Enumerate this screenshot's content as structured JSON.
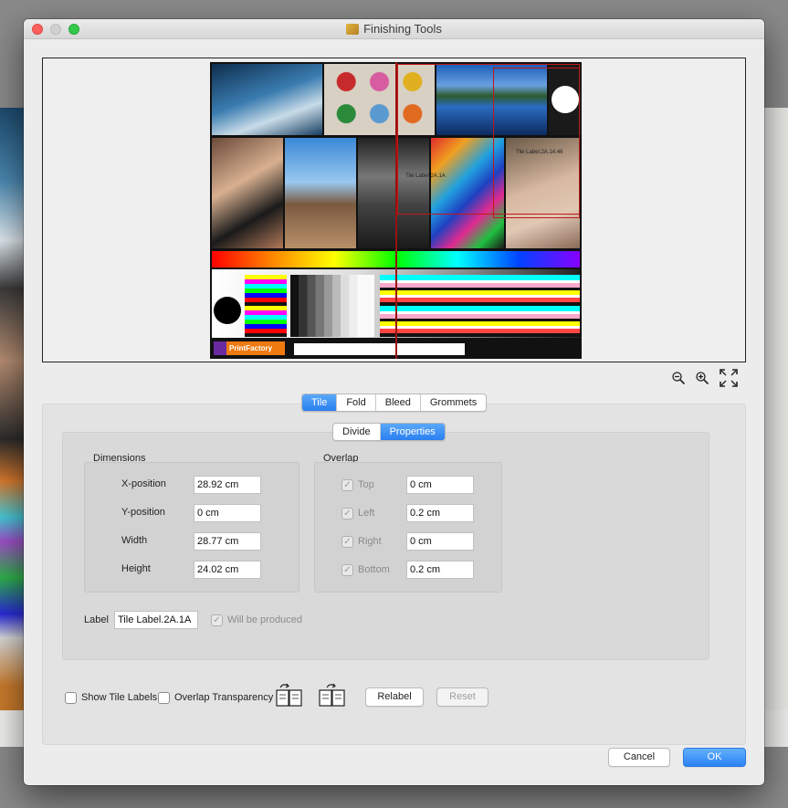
{
  "window": {
    "title": "Finishing Tools"
  },
  "preview": {
    "zoom_out_icon": "zoom-out-icon",
    "zoom_in_icon": "zoom-in-icon",
    "fit_icon": "fit-to-window-icon",
    "tile_label_1": "Tile Label.2A.1A",
    "tile_label_2": "Tile Label.2A.14.46"
  },
  "main_tabs": [
    {
      "label": "Tile",
      "active": true
    },
    {
      "label": "Fold",
      "active": false
    },
    {
      "label": "Bleed",
      "active": false
    },
    {
      "label": "Grommets",
      "active": false
    }
  ],
  "sub_tabs": [
    {
      "label": "Divide",
      "active": false
    },
    {
      "label": "Properties",
      "active": true
    }
  ],
  "dimensions": {
    "title": "Dimensions",
    "x_label": "X-position",
    "x_value": "28.92 cm",
    "y_label": "Y-position",
    "y_value": "0 cm",
    "width_label": "Width",
    "width_value": "28.77 cm",
    "height_label": "Height",
    "height_value": "24.02 cm"
  },
  "overlap": {
    "title": "Overlap",
    "top_label": "Top",
    "top_value": "0 cm",
    "top_checked": true,
    "left_label": "Left",
    "left_value": "0.2 cm",
    "left_checked": true,
    "right_label": "Right",
    "right_value": "0 cm",
    "right_checked": true,
    "bottom_label": "Bottom",
    "bottom_value": "0.2 cm",
    "bottom_checked": true
  },
  "label_row": {
    "label": "Label",
    "value": "Tile Label.2A.1A",
    "will_be_produced": "Will be produced",
    "will_be_produced_checked": true
  },
  "bottom_bar": {
    "show_tile_labels": "Show Tile Labels",
    "overlap_transparency": "Overlap Transparency",
    "relabel": "Relabel",
    "reset": "Reset"
  },
  "footer": {
    "cancel": "Cancel",
    "ok": "OK"
  },
  "brand": {
    "logo_text": "PrintFactory"
  },
  "colors": {
    "accent": "#2a7ff0",
    "tile_line": "#9a1010",
    "close": "#fc605c",
    "max": "#34c84a"
  }
}
